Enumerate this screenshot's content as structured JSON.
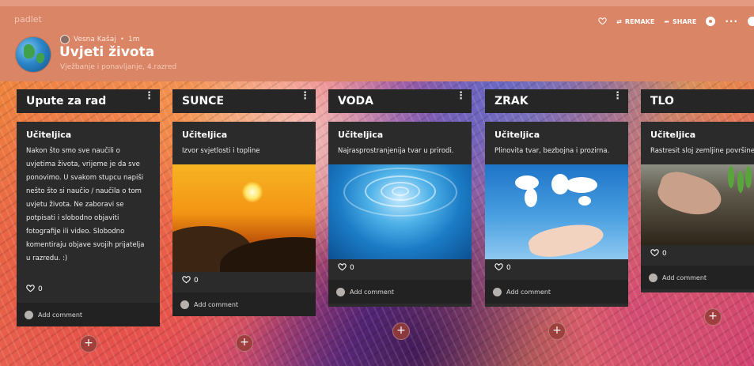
{
  "app": {
    "brand": "padlet"
  },
  "header": {
    "author": "Vesna Kašaj",
    "time": "1m",
    "title": "Uvjeti života",
    "subtitle": "Vježbanje i ponavljanje, 4.razred",
    "actions": {
      "remake": "REMAKE",
      "share": "SHARE"
    }
  },
  "columns": [
    {
      "title": "Upute za rad",
      "post": {
        "author": "Učiteljica",
        "body": "Nakon što smo sve naučili o uvjetima života, vrijeme je da sve ponovimo. U svakom stupcu napiši nešto što si naučio / naučila o tom uvjetu života. Ne zaboravi se potpisati i slobodno objaviti fotografije ili video. Slobodno komentiraju objave svojih prijatelja u razredu. :)",
        "likes": "0",
        "add_comment": "Add comment"
      }
    },
    {
      "title": "SUNCE",
      "post": {
        "author": "Učiteljica",
        "body": "Izvor svjetlosti i topline",
        "image": "sunset",
        "likes": "0",
        "add_comment": "Add comment"
      }
    },
    {
      "title": "VODA",
      "post": {
        "author": "Učiteljica",
        "body": "Najrasprostranjenija tvar u prirodi.",
        "image": "water-drop",
        "likes": "0",
        "add_comment": "Add comment"
      }
    },
    {
      "title": "ZRAK",
      "post": {
        "author": "Učiteljica",
        "body": "Plinovita tvar, bezbojna i prozirna.",
        "image": "cloud-world-map",
        "likes": "0",
        "add_comment": "Add comment"
      }
    },
    {
      "title": "TLO",
      "post": {
        "author": "Učiteljica",
        "body": "Rastresit sloj zemljine površine",
        "image": "hands-in-soil",
        "likes": "0",
        "add_comment": "Add comment"
      }
    }
  ],
  "add_post_symbol": "+"
}
